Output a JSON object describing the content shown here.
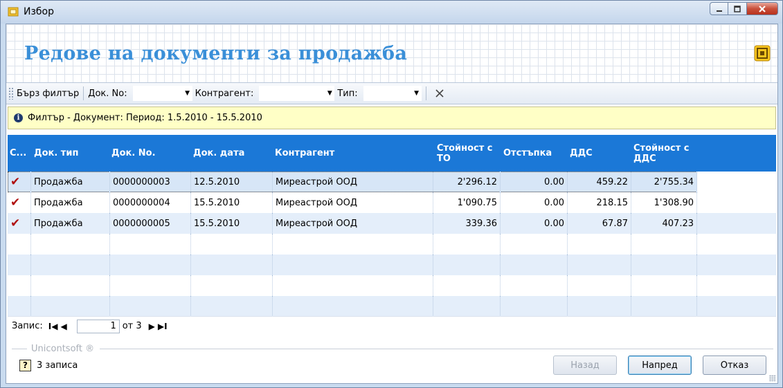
{
  "window": {
    "title": "Избор",
    "icon": "app-icon",
    "controls": [
      "minimize-icon",
      "maximize-icon",
      "close-icon"
    ]
  },
  "header": {
    "title": "Редове на документи за продажба",
    "brand_icon": "brand-icon"
  },
  "toolbar": {
    "quick_filter_label": "Бърз филтър",
    "doc_no_label": "Док. No:",
    "doc_no_value": "",
    "partner_label": "Контрагент:",
    "partner_value": "",
    "type_label": "Тип:",
    "type_value": "",
    "clear_icon": "clear-filter-icon"
  },
  "info": {
    "text": "Филтър - Документ: Период: 1.5.2010 - 15.5.2010"
  },
  "table": {
    "columns": [
      "С...",
      "Док. тип",
      "Док. No.",
      "Док. дата",
      "Контрагент",
      "Стойност с ТО",
      "Отстъпка",
      "ДДС",
      "Стойност с ДДС"
    ],
    "rows": [
      {
        "checked": "✔",
        "type": "Продажба",
        "no": "0000000003",
        "date": "12.5.2010",
        "partner": "Миреастрой ООД",
        "value_to": "2'296.12",
        "discount": "0.00",
        "vat": "459.22",
        "value_vat": "2'755.34"
      },
      {
        "checked": "✔",
        "type": "Продажба",
        "no": "0000000004",
        "date": "15.5.2010",
        "partner": "Миреастрой ООД",
        "value_to": "1'090.75",
        "discount": "0.00",
        "vat": "218.15",
        "value_vat": "1'308.90"
      },
      {
        "checked": "✔",
        "type": "Продажба",
        "no": "0000000005",
        "date": "15.5.2010",
        "partner": "Миреастрой ООД",
        "value_to": "339.36",
        "discount": "0.00",
        "vat": "67.87",
        "value_vat": "407.23"
      }
    ]
  },
  "pager": {
    "label": "Запис:",
    "current": "1",
    "of_text": "от 3",
    "first_label": "I◀",
    "prev_label": "◀",
    "next_label": "▶",
    "last_label": "▶I"
  },
  "footer": {
    "brand": "Unicontsoft ®",
    "status": "3 записа",
    "back_label": "Назад",
    "next_label": "Напред",
    "cancel_label": "Отказ"
  }
}
